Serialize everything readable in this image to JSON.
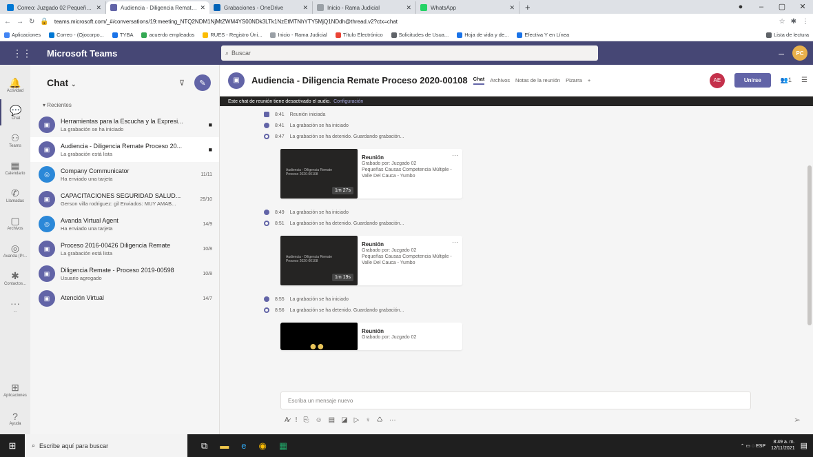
{
  "browser": {
    "tabs": [
      {
        "label": "Correo: Juzgado 02 Pequeñas C...",
        "color": "#0078d4"
      },
      {
        "label": "Audiencia - Diligencia Remate P...",
        "color": "#6264a7",
        "active": true
      },
      {
        "label": "Grabaciones - OneDrive",
        "color": "#0364b8"
      },
      {
        "label": "Inicio - Rama Judicial",
        "color": "#9aa0a6"
      },
      {
        "label": "WhatsApp",
        "color": "#25d366"
      }
    ],
    "new_tab": "+",
    "url": "teams.microsoft.com/_#/conversations/19:meeting_NTQ2NDM1NjMtZWM4YS00NDk3LTk1NzEtMTNhYTY5MjQ1NDdh@thread.v2?ctx=chat",
    "bookmarks": [
      {
        "label": "Aplicaciones",
        "color": "#4285f4"
      },
      {
        "label": "Correo - (Ojocorpo...",
        "color": "#0078d4"
      },
      {
        "label": "TYBA",
        "color": "#1a73e8"
      },
      {
        "label": "acuerdo empleados",
        "color": "#34a853"
      },
      {
        "label": "RUES - Registro Úni...",
        "color": "#fbbc04"
      },
      {
        "label": "Inicio - Rama Judicial",
        "color": "#9aa0a6"
      },
      {
        "label": "Título Electrónico",
        "color": "#ea4335"
      },
      {
        "label": "Solicitudes de Usua...",
        "color": "#5f6368"
      },
      {
        "label": "Hoja de vida y de...",
        "color": "#1a73e8"
      },
      {
        "label": "Efectiva Y en Línea",
        "color": "#1a73e8"
      }
    ],
    "reading_list": "Lista de lectura"
  },
  "teams": {
    "app_name": "Microsoft Teams",
    "search_placeholder": "Buscar",
    "user_initials": "PC",
    "rail": [
      {
        "label": "Actividad",
        "icon": "bell-icon"
      },
      {
        "label": "Chat",
        "icon": "chat-icon",
        "active": true
      },
      {
        "label": "Teams",
        "icon": "teams-icon"
      },
      {
        "label": "Calendario",
        "icon": "calendar-icon"
      },
      {
        "label": "Llamadas",
        "icon": "phone-icon"
      },
      {
        "label": "Archivos",
        "icon": "files-icon"
      },
      {
        "label": "Avanda (Pr...",
        "icon": "bot-icon"
      },
      {
        "label": "Contactos...",
        "icon": "contacts-icon"
      },
      {
        "label": "...",
        "icon": "more-icon"
      }
    ],
    "rail_bottom": [
      {
        "label": "Aplicaciones",
        "icon": "apps-icon"
      },
      {
        "label": "Ayuda",
        "icon": "help-icon"
      }
    ],
    "chat": {
      "title": "Chat",
      "recent_label": "Recientes",
      "items": [
        {
          "name": "Herramientas para la Escucha y la Expresi...",
          "preview": "La grabación se ha iniciado",
          "date": "",
          "icon": "meeting-icon"
        },
        {
          "name": "Audiencia - Diligencia Remate Proceso 20...",
          "preview": "La grabación está lista",
          "date": "",
          "icon": "meeting-icon",
          "selected": true
        },
        {
          "name": "Company Communicator",
          "preview": "Ha enviado una tarjeta",
          "date": "11/11",
          "icon": "bot-icon"
        },
        {
          "name": "CAPACITACIONES SEGURIDAD SALUD...",
          "preview": "Gerson villa rodriguez: gil Enviados: MUY AMAB...",
          "date": "29/10",
          "icon": "meeting-icon"
        },
        {
          "name": "Avanda Virtual Agent",
          "preview": "Ha enviado una tarjeta",
          "date": "14/9",
          "icon": "bot-icon"
        },
        {
          "name": "Proceso 2016-00426 Diligencia Remate",
          "preview": "La grabación está lista",
          "date": "10/8",
          "icon": "meeting-icon"
        },
        {
          "name": "Diligencia Remate - Proceso 2019-00598",
          "preview": "Usuario agregado",
          "date": "10/8",
          "icon": "meeting-icon"
        },
        {
          "name": "Atención Virtual",
          "preview": "",
          "date": "14/7",
          "icon": "meeting-icon"
        }
      ]
    },
    "conversation": {
      "title": "Audiencia - Diligencia Remate Proceso 2020-00108",
      "tabs": [
        "Chat",
        "Archivos",
        "Notas de la reunión",
        "Pizarra",
        "+"
      ],
      "participant_initials": "AE",
      "join_label": "Unirse",
      "participants_count": "1",
      "banner_text": "Este chat de reunión tiene desactivado el audio.",
      "banner_link": "Configuración",
      "events_1": [
        {
          "time": "8:41",
          "text": "Reunión iniciada",
          "kind": "meet"
        },
        {
          "time": "8:41",
          "text": "La grabación se ha iniciado",
          "kind": "start"
        },
        {
          "time": "8:47",
          "text": "La grabación se ha detenido. Guardando grabación...",
          "kind": "stop"
        }
      ],
      "recording_1": {
        "title": "Reunión",
        "by": "Grabado por: Juzgado 02",
        "org": "Pequeñas Causas Competencia Múltiple - Valle Del Cauca - Yumbo",
        "duration": "1m 27s",
        "thumb_text": "Audiencia - Diligencia Remate Proceso 2020-00108"
      },
      "events_2": [
        {
          "time": "8:49",
          "text": "La grabación se ha iniciado",
          "kind": "start"
        },
        {
          "time": "8:51",
          "text": "La grabación se ha detenido. Guardando grabación...",
          "kind": "stop"
        }
      ],
      "recording_2": {
        "title": "Reunión",
        "by": "Grabado por: Juzgado 02",
        "org": "Pequeñas Causas Competencia Múltiple - Valle Del Cauca - Yumbo",
        "duration": "1m 19s",
        "thumb_text": "Audiencia - Diligencia Remate Proceso 2020-00108"
      },
      "events_3": [
        {
          "time": "8:55",
          "text": "La grabación se ha iniciado",
          "kind": "start"
        },
        {
          "time": "8:56",
          "text": "La grabación se ha detenido. Guardando grabación...",
          "kind": "stop"
        }
      ],
      "recording_3": {
        "title": "Reunión",
        "by": "Grabado por: Juzgado 02"
      },
      "compose_placeholder": "Escriba un mensaje nuevo"
    }
  },
  "taskbar": {
    "search_placeholder": "Escribe aquí para buscar",
    "time": "8:49 a. m.",
    "date": "12/11/2021"
  }
}
